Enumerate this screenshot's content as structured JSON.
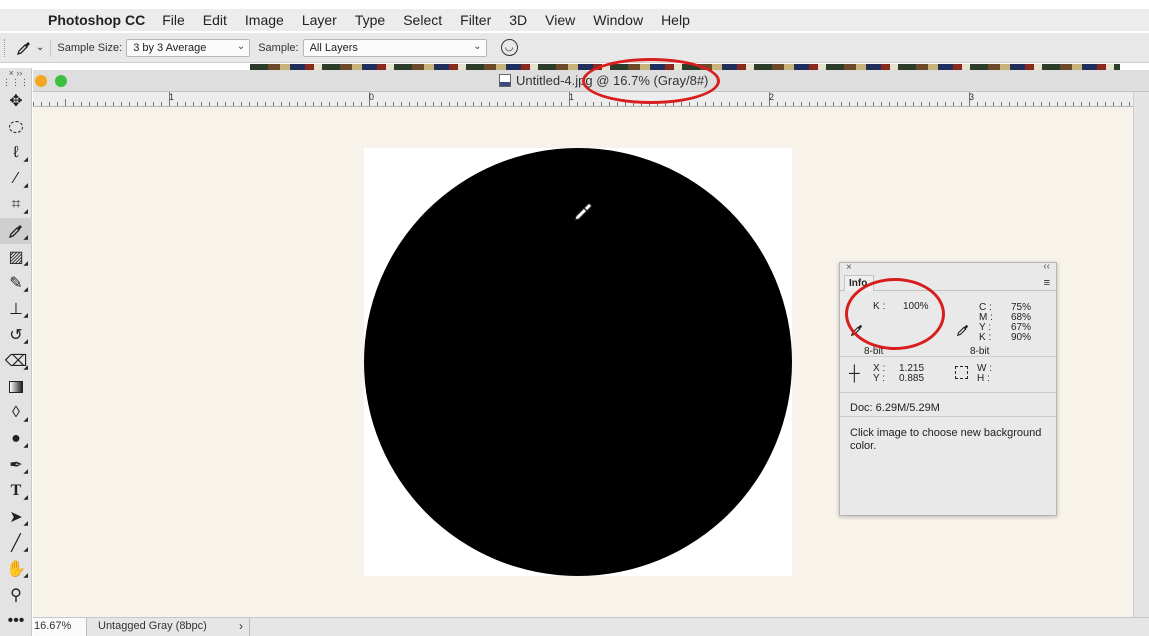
{
  "menubar": {
    "apple": "",
    "app_name": "Photoshop CC",
    "items": [
      "File",
      "Edit",
      "Image",
      "Layer",
      "Type",
      "Select",
      "Filter",
      "3D",
      "View",
      "Window",
      "Help"
    ]
  },
  "options": {
    "tool_icon": "eyedropper-icon",
    "sample_size_label": "Sample Size:",
    "sample_size_value": "3 by 3 Average",
    "sample_label": "Sample:",
    "sample_value": "All Layers",
    "show_ring_icon": "sampling-ring-icon"
  },
  "document": {
    "title": "Untitled-4.jpg @ 16.7% (Gray/8#)",
    "ruler_labels": [
      "1",
      "0",
      "1",
      "2",
      "3"
    ],
    "image_color": "#000000",
    "pasteboard_color": "#f7f3ea"
  },
  "status": {
    "zoom": "16.67%",
    "profile": "Untagged Gray (8bpc)",
    "arrow": "›"
  },
  "info_panel": {
    "close": "×",
    "collapse": "‹‹",
    "tab": "Info",
    "menu": "≡",
    "primary": {
      "label": "K :",
      "value": "100%",
      "bits": "8-bit"
    },
    "secondary": [
      {
        "label": "C :",
        "value": "75%"
      },
      {
        "label": "M :",
        "value": "68%"
      },
      {
        "label": "Y :",
        "value": "67%"
      },
      {
        "label": "K :",
        "value": "90%"
      }
    ],
    "secondary_bits": "8-bit",
    "x_label": "X :",
    "x_value": "1.215",
    "y_label": "Y :",
    "y_value": "0.885",
    "w_label": "W :",
    "h_label": "H :",
    "doc_size": "Doc: 6.29M/5.29M",
    "hint": "Click image to choose new background color."
  },
  "annotation_color": "#d81d1d"
}
